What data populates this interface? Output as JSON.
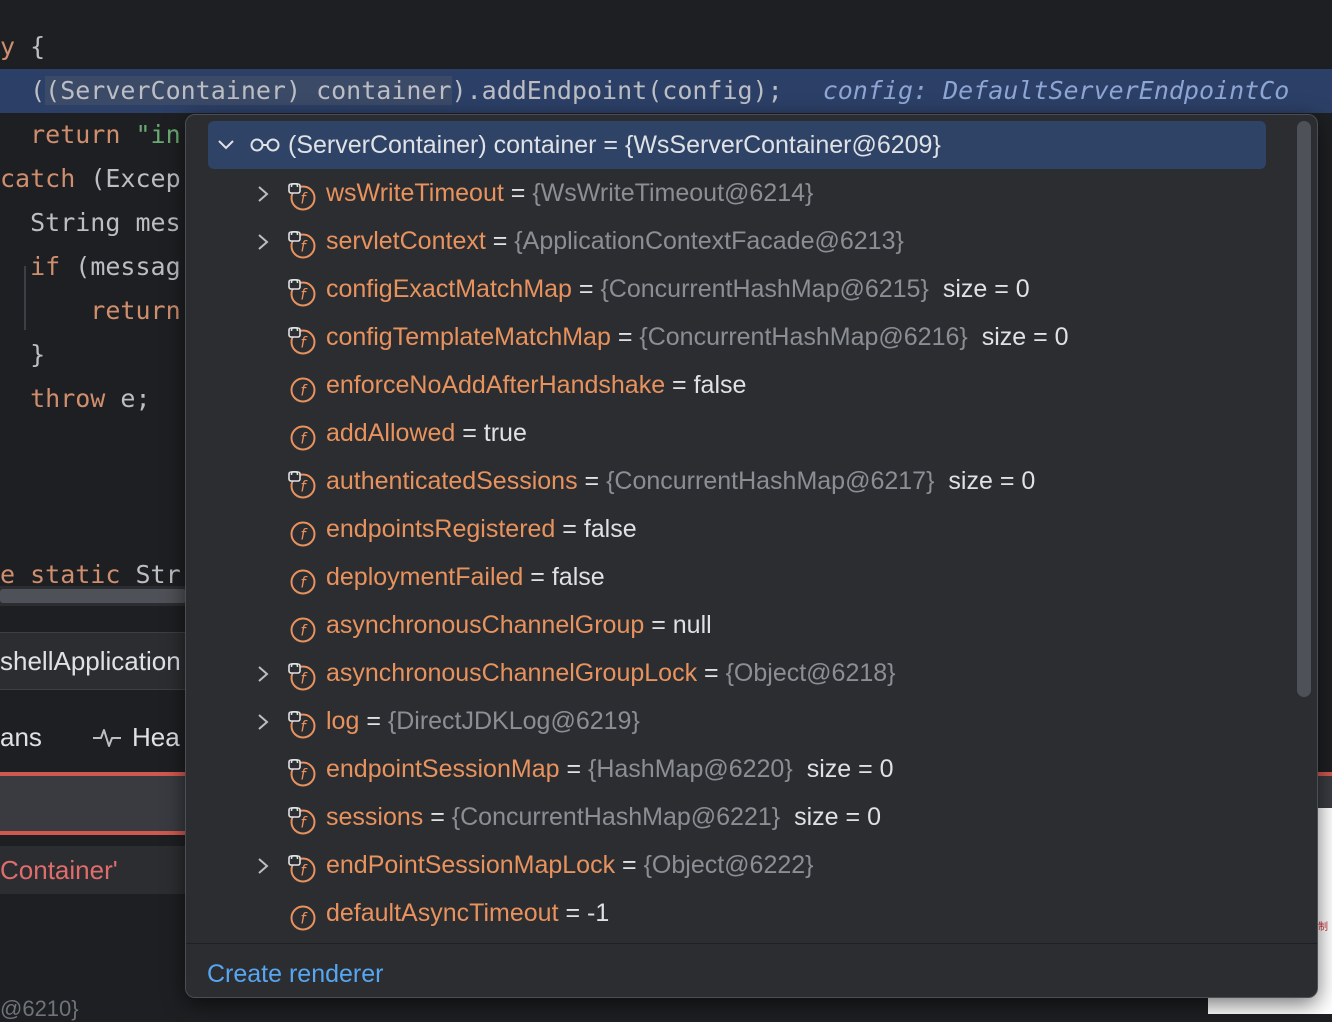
{
  "editor": {
    "lines": [
      {
        "parts": [
          {
            "cls": "kw",
            "t": "y"
          },
          {
            "cls": "plain",
            "t": " {"
          }
        ]
      },
      {
        "parts": [
          {
            "cls": "plain",
            "t": "  ("
          },
          {
            "cls": "plain sel",
            "t": "(ServerContainer) container"
          },
          {
            "cls": "plain",
            "t": ").addEndpoint(config);"
          }
        ],
        "inlay": "config: DefaultServerEndpointCo"
      },
      {
        "parts": [
          {
            "cls": "kw",
            "t": "  return "
          },
          {
            "cls": "str",
            "t": "\"in"
          }
        ]
      },
      {
        "parts": [
          {
            "cls": "kw",
            "t": "catch"
          },
          {
            "cls": "plain",
            "t": " (Excep"
          }
        ]
      },
      {
        "parts": [
          {
            "cls": "plain",
            "t": "  String mes"
          }
        ]
      },
      {
        "parts": [
          {
            "cls": "kw",
            "t": "  if"
          },
          {
            "cls": "plain",
            "t": " (messag"
          }
        ]
      },
      {
        "parts": [
          {
            "cls": "kw",
            "t": "      return"
          }
        ]
      },
      {
        "parts": [
          {
            "cls": "plain",
            "t": "  }"
          }
        ]
      },
      {
        "parts": [
          {
            "cls": "kw",
            "t": "  throw"
          },
          {
            "cls": "plain",
            "t": " e;"
          }
        ]
      },
      {
        "parts": [
          {
            "cls": "plain",
            "t": ""
          }
        ]
      },
      {
        "parts": [
          {
            "cls": "plain",
            "t": ""
          }
        ]
      },
      {
        "parts": [
          {
            "cls": "kw",
            "t": "e static "
          },
          {
            "cls": "plain",
            "t": "Str"
          }
        ]
      }
    ]
  },
  "panels": {
    "run_tab_label": "shellApplication",
    "tab_beans": "ans",
    "tab_health": "Hea",
    "error_text": "Container'",
    "bottom_fragment": "@6210}",
    "white_mark": "制"
  },
  "popup": {
    "root": {
      "expression": "(ServerContainer) container",
      "eq": " = ",
      "value": "{WsServerContainer@6209}"
    },
    "fields": [
      {
        "name": "wsWriteTimeout",
        "ref": "{WsWriteTimeout@6214}",
        "expandable": true,
        "icon": "field-locked-icon"
      },
      {
        "name": "servletContext",
        "ref": "{ApplicationContextFacade@6213}",
        "expandable": true,
        "icon": "field-locked-icon"
      },
      {
        "name": "configExactMatchMap",
        "ref": "{ConcurrentHashMap@6215}",
        "size": "size = 0",
        "expandable": false,
        "icon": "field-locked-icon"
      },
      {
        "name": "configTemplateMatchMap",
        "ref": "{ConcurrentHashMap@6216}",
        "size": "size = 0",
        "expandable": false,
        "icon": "field-locked-icon"
      },
      {
        "name": "enforceNoAddAfterHandshake",
        "value": "false",
        "expandable": false,
        "icon": "field-icon"
      },
      {
        "name": "addAllowed",
        "value": "true",
        "expandable": false,
        "icon": "field-icon"
      },
      {
        "name": "authenticatedSessions",
        "ref": "{ConcurrentHashMap@6217}",
        "size": "size = 0",
        "expandable": false,
        "icon": "field-locked-icon"
      },
      {
        "name": "endpointsRegistered",
        "value": "false",
        "expandable": false,
        "icon": "field-icon"
      },
      {
        "name": "deploymentFailed",
        "value": "false",
        "expandable": false,
        "icon": "field-icon"
      },
      {
        "name": "asynchronousChannelGroup",
        "value": "null",
        "expandable": false,
        "icon": "field-icon"
      },
      {
        "name": "asynchronousChannelGroupLock",
        "ref": "{Object@6218}",
        "expandable": true,
        "icon": "field-locked-icon"
      },
      {
        "name": "log",
        "ref": "{DirectJDKLog@6219}",
        "expandable": true,
        "icon": "field-locked-icon"
      },
      {
        "name": "endpointSessionMap",
        "ref": "{HashMap@6220}",
        "size": "size = 0",
        "expandable": false,
        "icon": "field-locked-icon"
      },
      {
        "name": "sessions",
        "ref": "{ConcurrentHashMap@6221}",
        "size": "size = 0",
        "expandable": false,
        "icon": "field-locked-icon"
      },
      {
        "name": "endPointSessionMapLock",
        "ref": "{Object@6222}",
        "expandable": true,
        "icon": "field-locked-icon"
      },
      {
        "name": "defaultAsyncTimeout",
        "value": "-1",
        "expandable": false,
        "icon": "field-icon"
      }
    ],
    "footer_link": "Create renderer"
  },
  "colors": {
    "field_name": "#e8925e",
    "link": "#57a6f2",
    "selection": "#2e4366"
  }
}
